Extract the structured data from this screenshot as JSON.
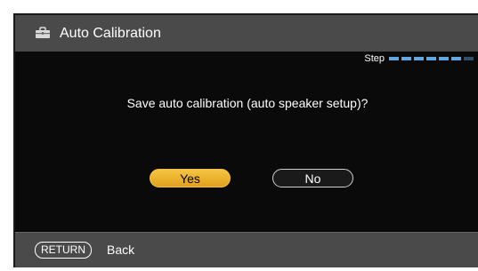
{
  "header": {
    "title": "Auto Calibration",
    "icon": "toolbox-icon"
  },
  "step": {
    "label": "Step",
    "total_steps": 7,
    "completed_steps": 6,
    "active_color": "#5fa8e6"
  },
  "dialog": {
    "question": "Save auto calibration (auto speaker setup)?",
    "yes_label": "Yes",
    "no_label": "No",
    "selected": "Yes",
    "selected_color": "#f0b830"
  },
  "footer": {
    "return_key": "RETURN",
    "back_label": "Back"
  }
}
